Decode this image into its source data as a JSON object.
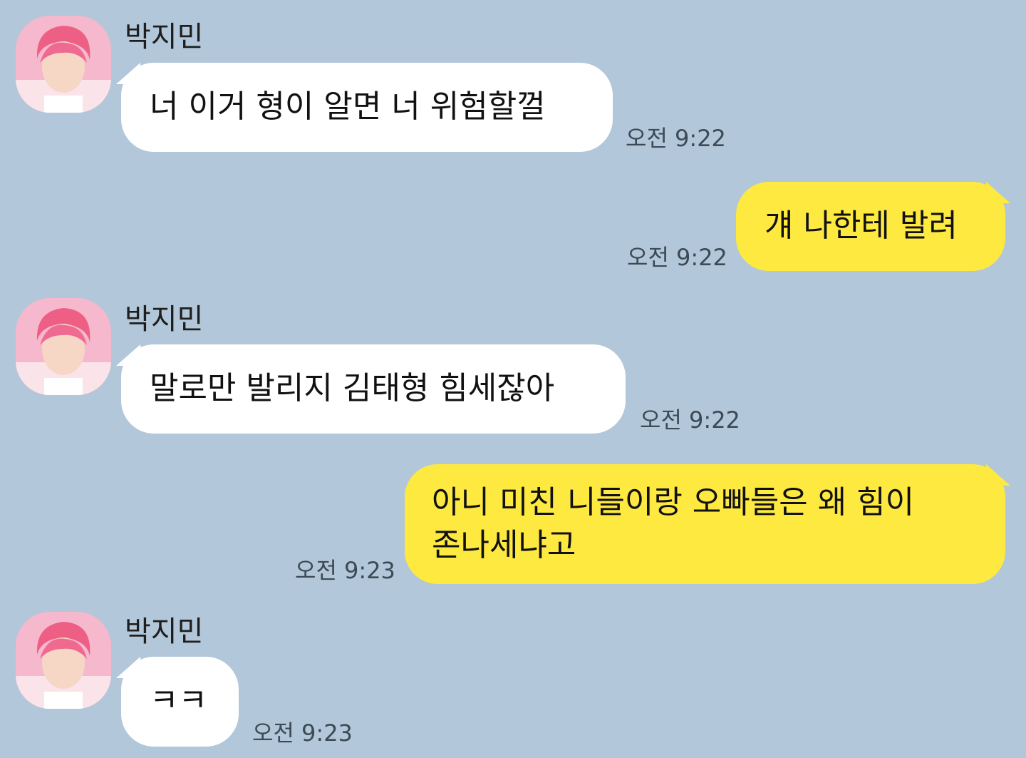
{
  "chat": {
    "sender": "박지민",
    "messages": [
      {
        "direction": "in",
        "text": "너 이거 형이 알면 너 위험할껄",
        "time": "오전 9:22"
      },
      {
        "direction": "out",
        "text": "걔 나한테 발려",
        "time": "오전 9:22"
      },
      {
        "direction": "in",
        "text": "말로만 발리지 김태형 힘세잖아",
        "time": "오전 9:22"
      },
      {
        "direction": "out",
        "text_line1": "아니 미친 니들이랑 오빠들은 왜 힘이",
        "text_line2": "존나세냐고",
        "time": "오전 9:23"
      },
      {
        "direction": "in",
        "text": "ㅋㅋ",
        "time": "오전 9:23"
      }
    ]
  },
  "colors": {
    "background": "#b2c7d9",
    "incoming_bubble": "#ffffff",
    "outgoing_bubble": "#fee940"
  },
  "icons": {
    "avatar": "profile-avatar"
  }
}
